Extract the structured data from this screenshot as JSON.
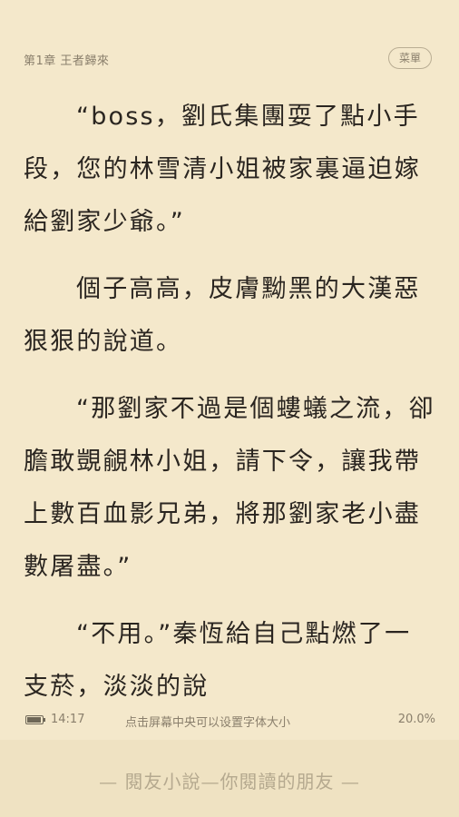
{
  "header": {
    "chapter_title": "第1章  王者歸來",
    "menu_label": "菜單"
  },
  "content": {
    "paragraphs": [
      "“boss，劉氏集團耍了點小手段，您的林雪清小姐被家裏逼迫嫁給劉家少爺。”",
      "個子高高，皮膚黝黑的大漢惡狠狠的說道。",
      "“那劉家不過是個螻蟻之流，卻膽敢覬覦林小姐，請下令，讓我帶上數百血影兄弟，將那劉家老小盡數屠盡。”",
      "“不用。”秦恆給自己點燃了一支菸，淡淡的說"
    ]
  },
  "status": {
    "battery_icon": "battery-icon",
    "time": "14:17",
    "hint": "点击屏幕中央可以设置字体大小",
    "progress": "20.0%"
  },
  "footer": {
    "text": "— 閱友小說—你閱讀的朋友 —"
  }
}
